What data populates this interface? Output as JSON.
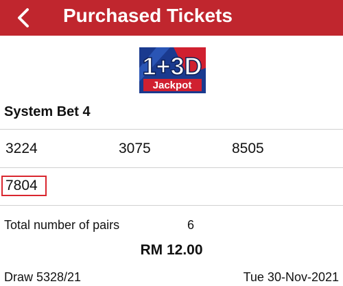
{
  "header": {
    "title": "Purchased Tickets",
    "back_icon": "chevron-left-icon",
    "background_color": "#c0262e"
  },
  "logo": {
    "main_text": "1+3D",
    "sub_text": "Jackpot"
  },
  "ticket": {
    "bet_type": "System Bet 4",
    "numbers": [
      "3224",
      "3075",
      "8505",
      "7804"
    ],
    "pairs_label": "Total number of pairs",
    "pairs_value": "6",
    "amount": "RM 12.00",
    "draw": "Draw 5328/21",
    "date": "Tue 30-Nov-2021"
  },
  "highlight_color": "#d9262e"
}
